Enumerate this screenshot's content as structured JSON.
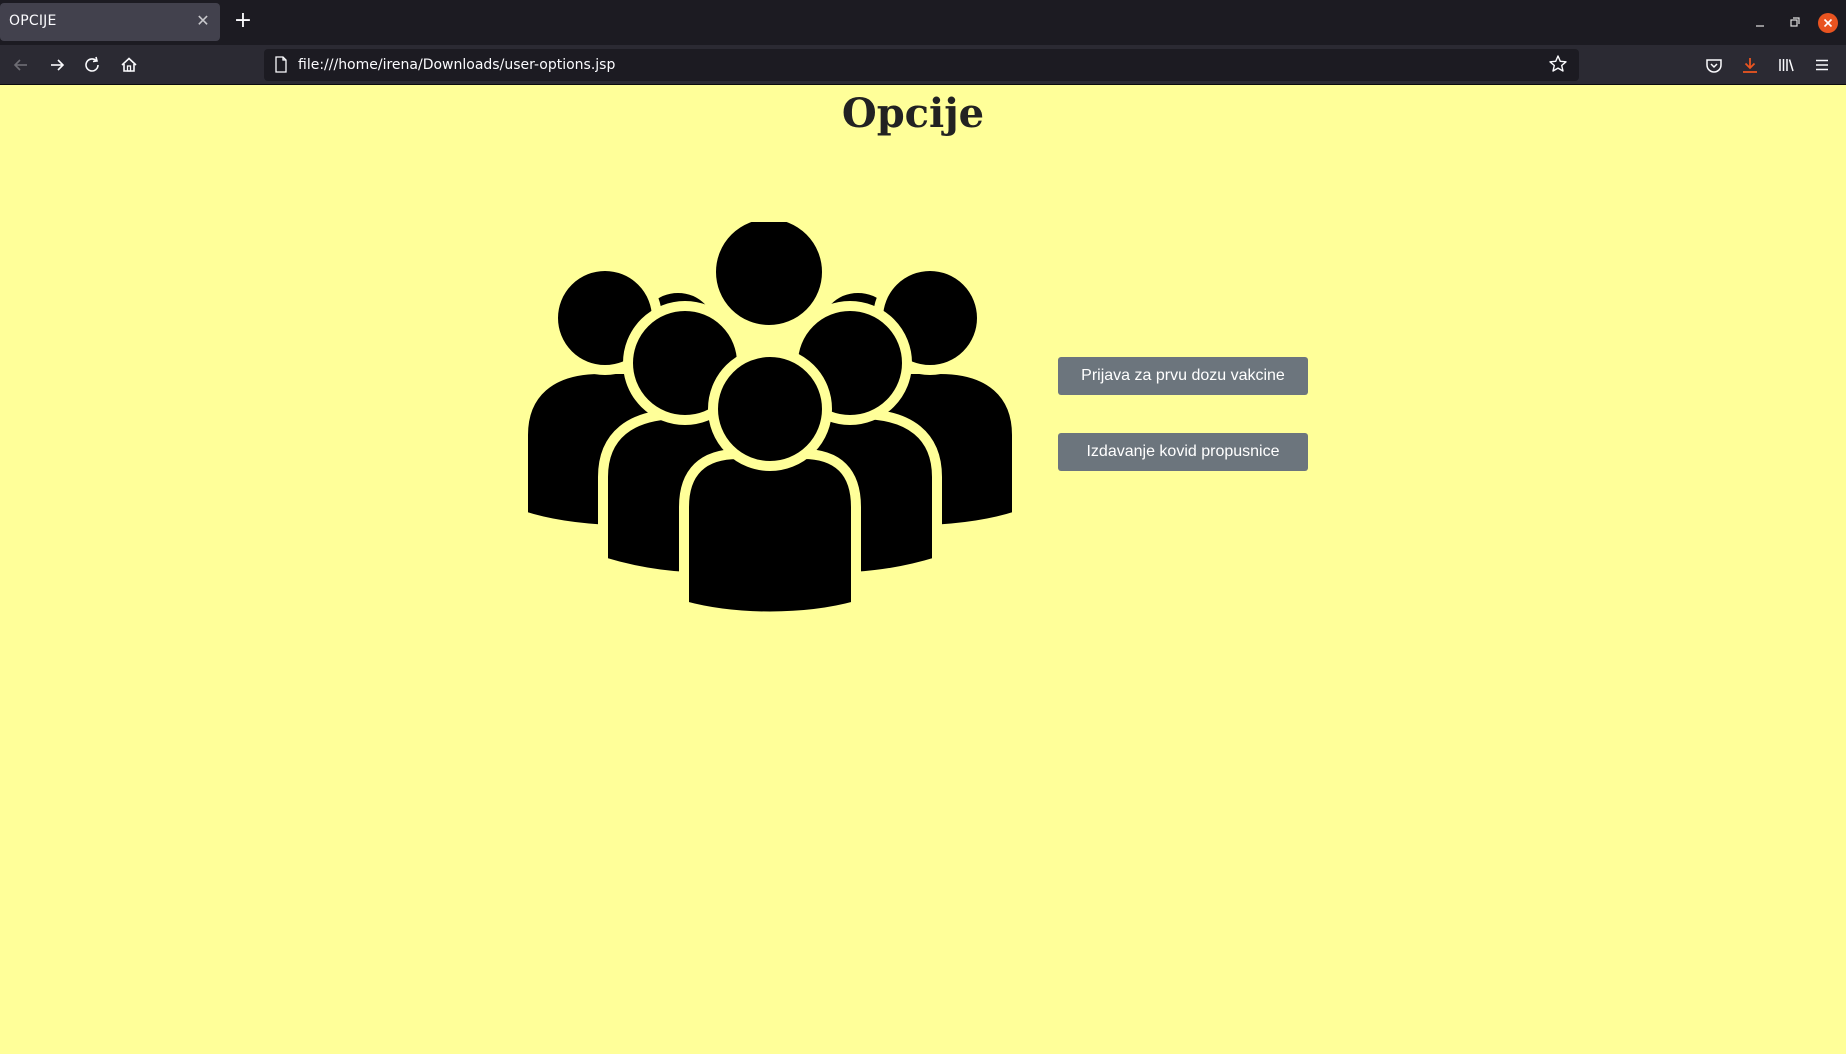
{
  "browser": {
    "tab_title": "OPCIJE",
    "tab_close_glyph": "✕",
    "new_tab_glyph": "+",
    "url": "file:///home/irena/Downloads/user-options.jsp",
    "icons": [
      "back-arrow-icon",
      "forward-arrow-icon",
      "reload-icon",
      "home-icon",
      "page-icon",
      "bookmark-star-icon",
      "pocket-icon",
      "download-icon",
      "library-icon",
      "menu-icon"
    ]
  },
  "page": {
    "title": "Opcije",
    "icon": "people-group-icon",
    "buttons": {
      "first_dose": "Prijava za prvu dozu vakcine",
      "covid_pass": "Izdavanje kovid propusnice"
    }
  },
  "colors": {
    "page_background": "#ffff99",
    "button_background": "#6c757d",
    "button_text": "#ffffff",
    "icon_fill": "#000000",
    "window_close": "#e95420"
  }
}
